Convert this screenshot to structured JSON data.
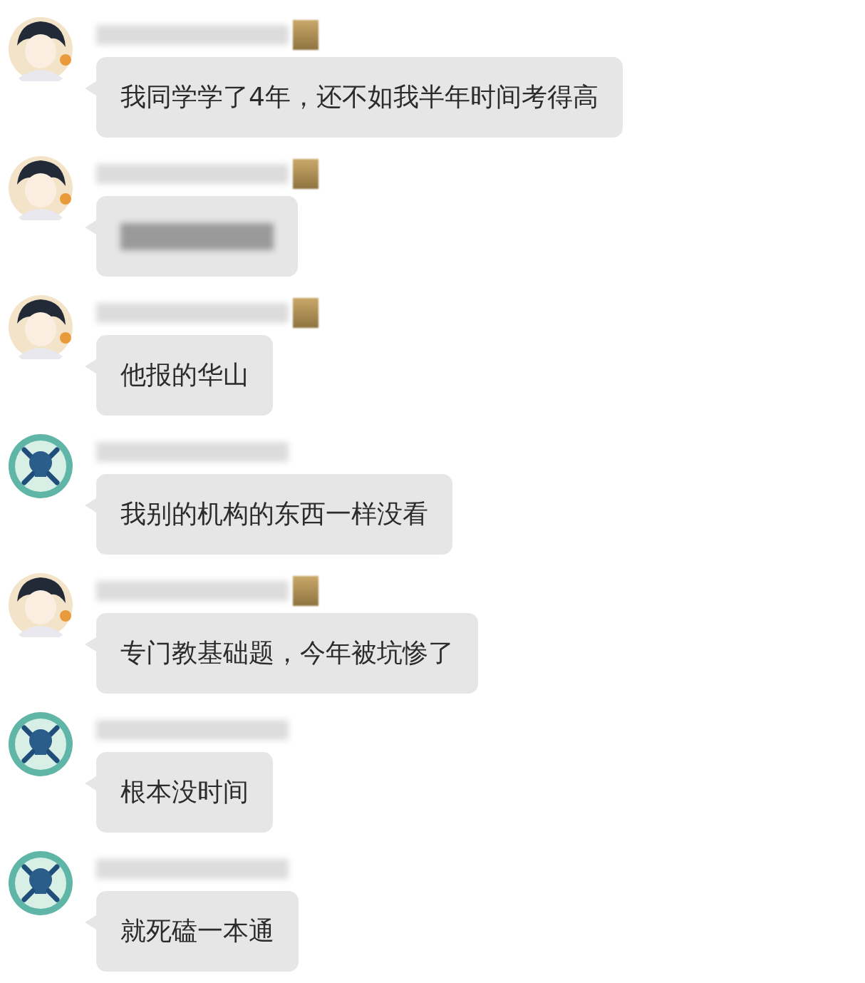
{
  "messages": [
    {
      "kind": "boy",
      "badge": true,
      "redacted": false,
      "text": "我同学学了4年，还不如我半年时间考得高"
    },
    {
      "kind": "boy",
      "badge": true,
      "redacted": true
    },
    {
      "kind": "boy",
      "badge": true,
      "redacted": false,
      "text": "他报的华山"
    },
    {
      "kind": "skull",
      "badge": false,
      "redacted": false,
      "text": "我别的机构的东西一样没看"
    },
    {
      "kind": "boy",
      "badge": true,
      "redacted": false,
      "text": "专门教基础题，今年被坑惨了"
    },
    {
      "kind": "skull",
      "badge": false,
      "redacted": false,
      "text": "根本没时间"
    },
    {
      "kind": "skull",
      "badge": false,
      "redacted": false,
      "text": "就死磕一本通"
    }
  ]
}
